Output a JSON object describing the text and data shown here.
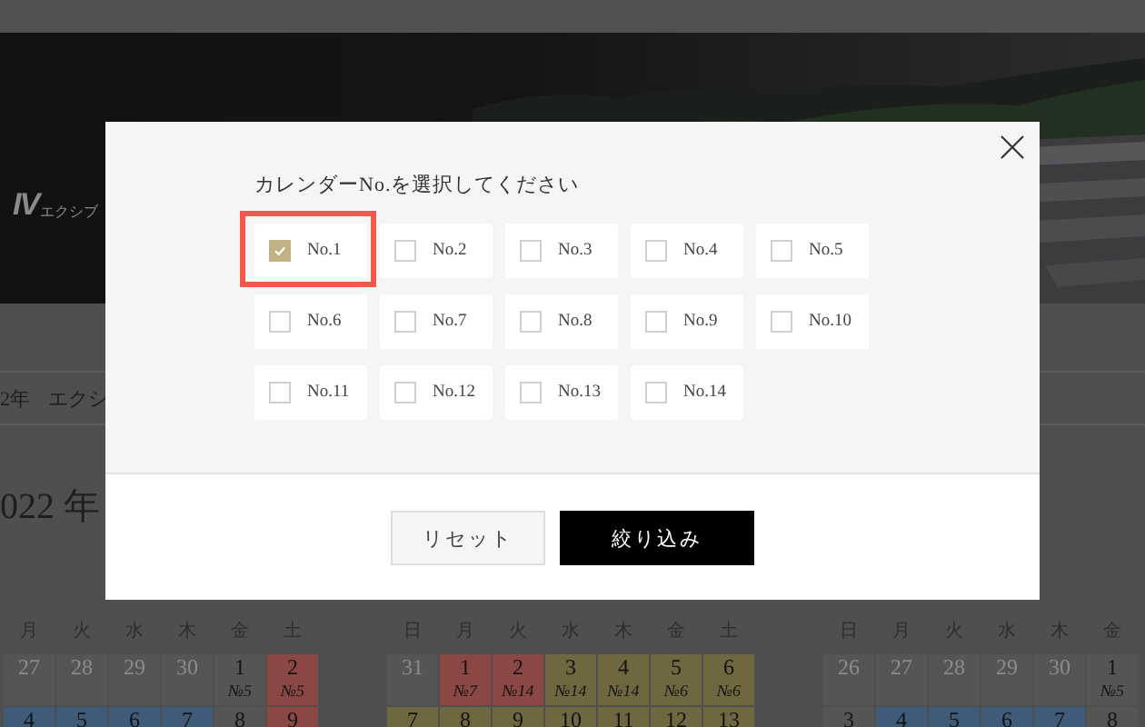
{
  "logo": {
    "text": "IV",
    "subtext": "エクシブ"
  },
  "band": {
    "items": [
      "2年",
      "エクシ"
    ]
  },
  "year_heading": "022 年",
  "calendars": [
    {
      "weekdays": [
        "月",
        "火",
        "水",
        "木",
        "金",
        "土"
      ],
      "weeks": [
        [
          {
            "day": "27",
            "muted": true,
            "color": "#555555"
          },
          {
            "day": "28",
            "muted": true,
            "color": "#555555"
          },
          {
            "day": "29",
            "muted": true,
            "color": "#555555"
          },
          {
            "day": "30",
            "muted": true,
            "color": "#555555"
          },
          {
            "day": "1",
            "note": "№5",
            "muted": false,
            "color": "#555555"
          },
          {
            "day": "2",
            "note": "№5",
            "muted": false,
            "color": "#8b4743"
          }
        ],
        [
          {
            "day": "4",
            "muted": false,
            "color": "#3f5b78"
          },
          {
            "day": "5",
            "muted": false,
            "color": "#3f5b78"
          },
          {
            "day": "6",
            "muted": false,
            "color": "#3f5b78"
          },
          {
            "day": "7",
            "muted": false,
            "color": "#3f5b78"
          },
          {
            "day": "8",
            "muted": false,
            "color": "#555555"
          },
          {
            "day": "9",
            "muted": false,
            "color": "#8b4743"
          }
        ]
      ]
    },
    {
      "weekdays": [
        "日",
        "月",
        "火",
        "水",
        "木",
        "金",
        "土"
      ],
      "weeks": [
        [
          {
            "day": "31",
            "muted": true,
            "color": "#555555"
          },
          {
            "day": "1",
            "note": "№7",
            "muted": false,
            "color": "#8b4743"
          },
          {
            "day": "2",
            "note": "№14",
            "muted": false,
            "color": "#8b4743"
          },
          {
            "day": "3",
            "note": "№14",
            "muted": false,
            "color": "#6f673f"
          },
          {
            "day": "4",
            "note": "№14",
            "muted": false,
            "color": "#6f673f"
          },
          {
            "day": "5",
            "note": "№6",
            "muted": false,
            "color": "#6f673f"
          },
          {
            "day": "6",
            "note": "№6",
            "muted": false,
            "color": "#6f673f"
          }
        ],
        [
          {
            "day": "7",
            "muted": false,
            "color": "#6f673f"
          },
          {
            "day": "8",
            "muted": false,
            "color": "#6f673f"
          },
          {
            "day": "9",
            "muted": false,
            "color": "#6f673f"
          },
          {
            "day": "10",
            "muted": false,
            "color": "#6f673f"
          },
          {
            "day": "11",
            "muted": false,
            "color": "#6f673f"
          },
          {
            "day": "12",
            "muted": false,
            "color": "#6f673f"
          },
          {
            "day": "13",
            "muted": false,
            "color": "#6f673f"
          }
        ]
      ]
    },
    {
      "weekdays": [
        "日",
        "月",
        "火",
        "水",
        "木",
        "金"
      ],
      "weeks": [
        [
          {
            "day": "26",
            "muted": true,
            "color": "#555555"
          },
          {
            "day": "27",
            "muted": true,
            "color": "#555555"
          },
          {
            "day": "28",
            "muted": true,
            "color": "#555555"
          },
          {
            "day": "29",
            "muted": true,
            "color": "#555555"
          },
          {
            "day": "30",
            "muted": true,
            "color": "#555555"
          },
          {
            "day": "1",
            "note": "№5",
            "muted": false,
            "color": "#555555"
          }
        ],
        [
          {
            "day": "3",
            "muted": false,
            "color": "#555555"
          },
          {
            "day": "4",
            "muted": false,
            "color": "#3f5b78"
          },
          {
            "day": "5",
            "muted": false,
            "color": "#3f5b78"
          },
          {
            "day": "6",
            "muted": false,
            "color": "#3f5b78"
          },
          {
            "day": "7",
            "muted": false,
            "color": "#3f5b78"
          },
          {
            "day": "8",
            "muted": false,
            "color": "#555555"
          }
        ]
      ]
    }
  ],
  "modal": {
    "title": "カレンダーNo.を選択してください",
    "options": [
      {
        "label": "No.1",
        "checked": true,
        "highlighted": true
      },
      {
        "label": "No.2",
        "checked": false,
        "highlighted": false
      },
      {
        "label": "No.3",
        "checked": false,
        "highlighted": false
      },
      {
        "label": "No.4",
        "checked": false,
        "highlighted": false
      },
      {
        "label": "No.5",
        "checked": false,
        "highlighted": false
      },
      {
        "label": "No.6",
        "checked": false,
        "highlighted": false
      },
      {
        "label": "No.7",
        "checked": false,
        "highlighted": false
      },
      {
        "label": "No.8",
        "checked": false,
        "highlighted": false
      },
      {
        "label": "No.9",
        "checked": false,
        "highlighted": false
      },
      {
        "label": "No.10",
        "checked": false,
        "highlighted": false
      },
      {
        "label": "No.11",
        "checked": false,
        "highlighted": false
      },
      {
        "label": "No.12",
        "checked": false,
        "highlighted": false
      },
      {
        "label": "No.13",
        "checked": false,
        "highlighted": false
      },
      {
        "label": "No.14",
        "checked": false,
        "highlighted": false
      }
    ],
    "buttons": [
      {
        "label": "リセット",
        "kind": "secondary"
      },
      {
        "label": "絞り込み",
        "kind": "primary"
      }
    ]
  }
}
